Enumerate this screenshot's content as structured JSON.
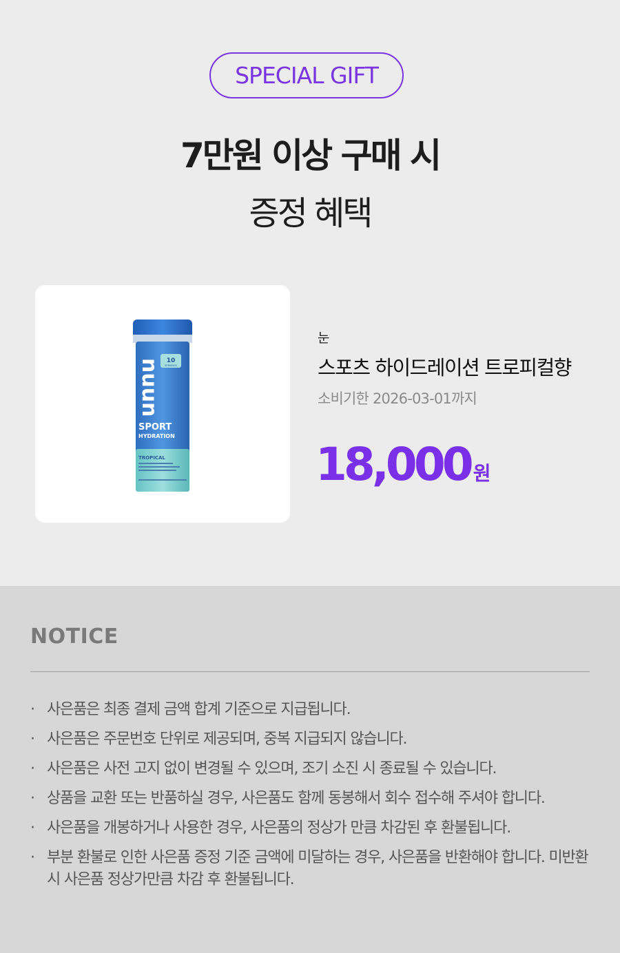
{
  "badge": "SPECIAL GIFT",
  "headline": "7만원 이상 구매 시",
  "subline": "증정 혜택",
  "product": {
    "brand": "눈",
    "name": "스포츠 하이드레이션 트로피컬향",
    "expiry": "소비기한 2026-03-01까지",
    "price": "18,000",
    "price_unit": "원",
    "image_text": {
      "logo": "nuun",
      "count": "10",
      "count_sub": "SERVINGS",
      "line1": "SPORT",
      "line2": "HYDRATION",
      "flavor": "TROPICAL"
    }
  },
  "notice": {
    "title": "NOTICE",
    "bullet": "·",
    "items": [
      "사은품은 최종 결제 금액 합계 기준으로 지급됩니다.",
      "사은품은 주문번호 단위로 제공되며, 중복 지급되지 않습니다.",
      "사은품은 사전 고지 없이 변경될 수 있으며, 조기 소진 시 종료될 수 있습니다.",
      "상품을 교환 또는 반품하실 경우, 사은품도 함께 동봉해서 회수 접수해 주셔야 합니다.",
      "사은품을 개봉하거나 사용한 경우, 사은품의 정상가 만큼 차감된 후 환불됩니다.",
      "부분 환불로 인한 사은품 증정 기준 금액에 미달하는 경우, 사은품을 반환해야 합니다. 미반환 시 사은품 정상가만큼 차감 후 환불됩니다."
    ]
  },
  "colors": {
    "accent": "#7a34e0",
    "top_bg": "#ececec",
    "notice_bg": "#d7d7d7"
  }
}
